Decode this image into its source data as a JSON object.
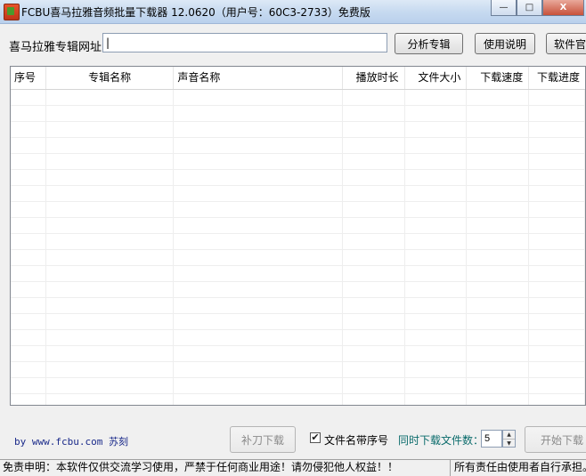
{
  "window": {
    "title": "FCBU喜马拉雅音频批量下载器 12.0620（用户号：60C3-2733）免费版",
    "minimize": "—",
    "maximize": "□",
    "close": "X"
  },
  "url_row": {
    "label": "喜马拉雅专辑网址：",
    "value": "|",
    "analyze_button": "分析专辑",
    "help_button": "使用说明",
    "website_button": "软件官"
  },
  "table": {
    "columns": [
      "序号",
      "专辑名称",
      "声音名称",
      "播放时长",
      "文件大小",
      "下载速度",
      "下载进度"
    ],
    "rows": []
  },
  "bottom": {
    "credit": "by www.fcbu.com 苏刻",
    "redownload_button": "补刀下载",
    "checkbox_checked": true,
    "checkbox_label": "文件名带序号",
    "concurrent_label": "同时下载文件数：",
    "concurrent_value": "5",
    "start_button": "开始下载"
  },
  "status_bar": {
    "disclaimer": "免责申明：本软件仅供交流学习使用，严禁于任何商业用途！请勿侵犯他人权益！！",
    "responsibility": "所有责任由使用者自行承担。"
  }
}
